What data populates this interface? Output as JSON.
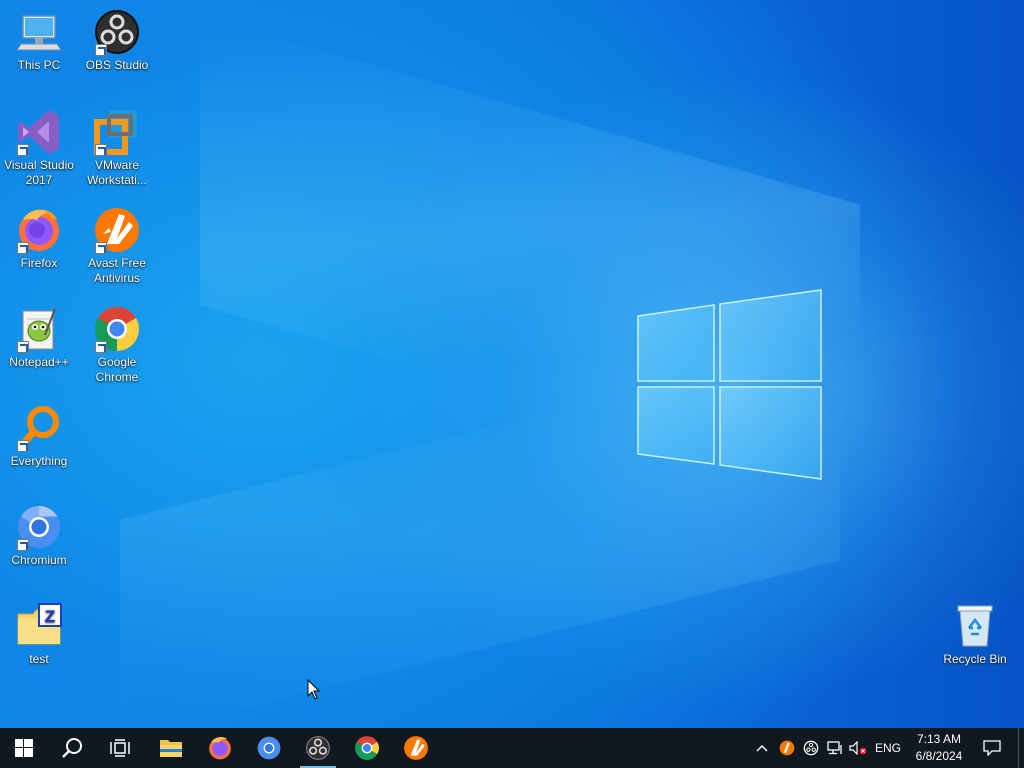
{
  "desktop": {
    "icons": [
      {
        "label": "This PC"
      },
      {
        "label": "OBS Studio"
      },
      {
        "label": "Visual Studio 2017"
      },
      {
        "label": "VMware Workstati..."
      },
      {
        "label": "Firefox"
      },
      {
        "label": "Avast Free Antivirus"
      },
      {
        "label": "Notepad++"
      },
      {
        "label": "Google Chrome"
      },
      {
        "label": "Everything"
      },
      {
        "label": "Chromium"
      },
      {
        "label": "test"
      },
      {
        "label": "Recycle Bin"
      }
    ]
  },
  "taskbar": {
    "start_icon": "windows-logo-icon",
    "search_icon": "search-icon",
    "task_view_icon": "task-view-icon",
    "pinned": [
      {
        "name": "File Explorer",
        "icon": "folder-icon"
      },
      {
        "name": "Firefox",
        "icon": "firefox-icon"
      },
      {
        "name": "Chromium",
        "icon": "chromium-icon"
      },
      {
        "name": "OBS Studio",
        "icon": "obs-icon"
      },
      {
        "name": "Google Chrome",
        "icon": "chrome-icon"
      },
      {
        "name": "Avast Free Antivirus",
        "icon": "avast-icon"
      }
    ],
    "tray": {
      "language": "ENG",
      "time": "7:13 AM",
      "date": "6/8/2024"
    }
  },
  "colors": {
    "taskbar_bg": "#101820",
    "desktop_blue": "#0c78e0",
    "accent_underline": "#76b9ed"
  }
}
